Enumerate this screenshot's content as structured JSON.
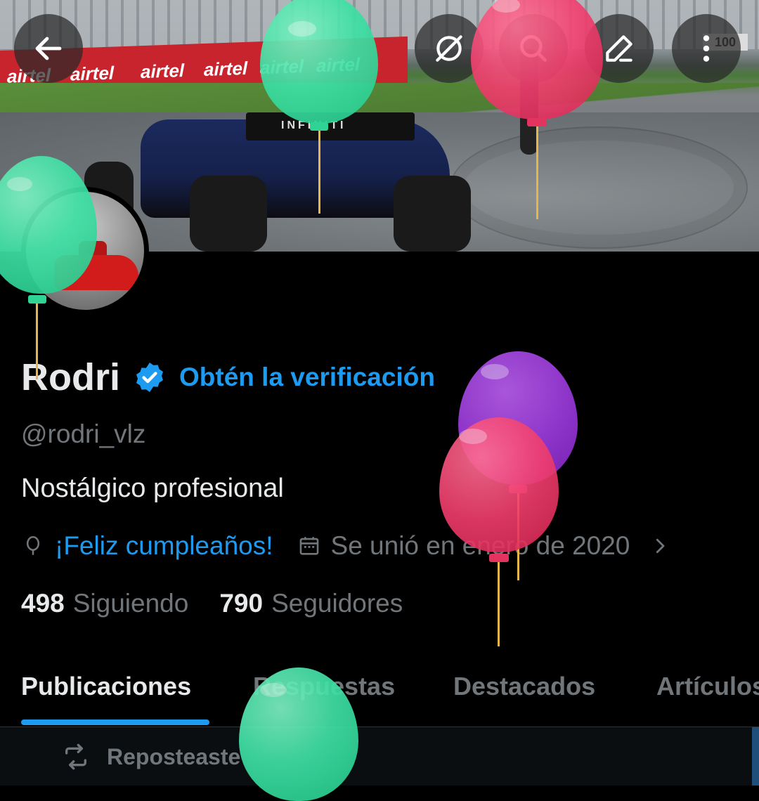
{
  "banner": {
    "ad_text": "airtel",
    "wing_text": "INFINITI",
    "board_text": "100"
  },
  "topbar": {
    "back": "back-arrow-icon",
    "grok": "slash-circle-icon",
    "search": "search-icon",
    "edit": "edit-pencil-icon",
    "more": "more-vertical-icon"
  },
  "profile": {
    "name": "Rodri",
    "get_verified": "Obtén la verificación",
    "handle": "@rodri_vlz",
    "bio": "Nostálgico profesional",
    "birthday": "¡Feliz cumpleaños!",
    "joined": "Se unió en enero de 2020"
  },
  "stats": {
    "following_count": "498",
    "following_label": "Siguiendo",
    "followers_count": "790",
    "followers_label": "Seguidores"
  },
  "tabs": {
    "posts": "Publicaciones",
    "replies": "Respuestas",
    "highlights": "Destacados",
    "articles": "Artículos"
  },
  "feed": {
    "repost_label": "Reposteaste"
  },
  "colors": {
    "accent": "#1d9bf0",
    "muted": "#71767b",
    "text": "#e7e9ea",
    "background": "#000000"
  }
}
